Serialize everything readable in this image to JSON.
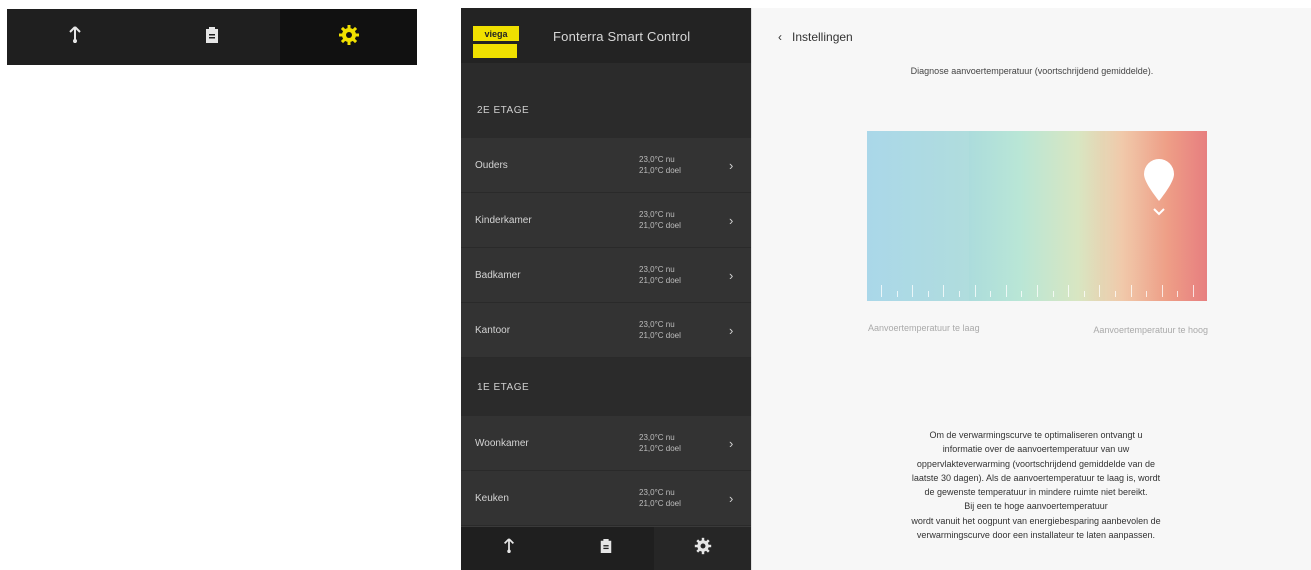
{
  "mini_tabbar": {
    "tabs": [
      {
        "icon": "thermometer-icon",
        "active": false
      },
      {
        "icon": "clipboard-icon",
        "active": false
      },
      {
        "icon": "gear-icon",
        "active": true
      }
    ],
    "active_color": "#f0e000"
  },
  "sidebar": {
    "logo_text": "viega",
    "app_title": "Fonterra Smart Control",
    "sections": [
      {
        "title": "2E ETAGE",
        "rooms": [
          {
            "name": "Ouders",
            "temp_now": "23,0°C nu",
            "temp_target": "21,0°C doel"
          },
          {
            "name": "Kinderkamer",
            "temp_now": "23,0°C nu",
            "temp_target": "21,0°C doel"
          },
          {
            "name": "Badkamer",
            "temp_now": "23,0°C nu",
            "temp_target": "21,0°C doel"
          },
          {
            "name": "Kantoor",
            "temp_now": "23,0°C nu",
            "temp_target": "21,0°C doel"
          }
        ]
      },
      {
        "title": "1E ETAGE",
        "rooms": [
          {
            "name": "Woonkamer",
            "temp_now": "23,0°C nu",
            "temp_target": "21,0°C doel"
          },
          {
            "name": "Keuken",
            "temp_now": "23,0°C nu",
            "temp_target": "21,0°C doel"
          }
        ]
      }
    ],
    "tabbar": [
      {
        "icon": "thermometer-icon",
        "active": false
      },
      {
        "icon": "clipboard-icon",
        "active": false
      },
      {
        "icon": "gear-icon",
        "active": true
      }
    ]
  },
  "main": {
    "back_label": "Instellingen",
    "intro": "Diagnose aanvoertemperatuur (voortschrijdend gemiddelde).",
    "gauge": {
      "level": 0.86,
      "colors": [
        "#a6d5e8",
        "#b9e6d6",
        "#f0c8a8",
        "#e77b7b"
      ]
    },
    "label_low": "Aanvoertemperatuur te laag",
    "label_high": "Aanvoertemperatuur te hoog",
    "body_lines": [
      "Om de verwarmingscurve te optimaliseren ontvangt u",
      "informatie over de aanvoertemperatuur van uw",
      "oppervlakteverwarming (voortschrijdend gemiddelde van de",
      "laatste 30 dagen). Als de aanvoertemperatuur te laag is, wordt",
      "de gewenste temperatuur in mindere ruimte niet bereikt.",
      "Bij een te hoge aanvoertemperatuur",
      "wordt vanuit het oogpunt van energiebesparing aanbevolen de",
      "verwarmingscurve door een installateur te laten aanpassen."
    ]
  }
}
